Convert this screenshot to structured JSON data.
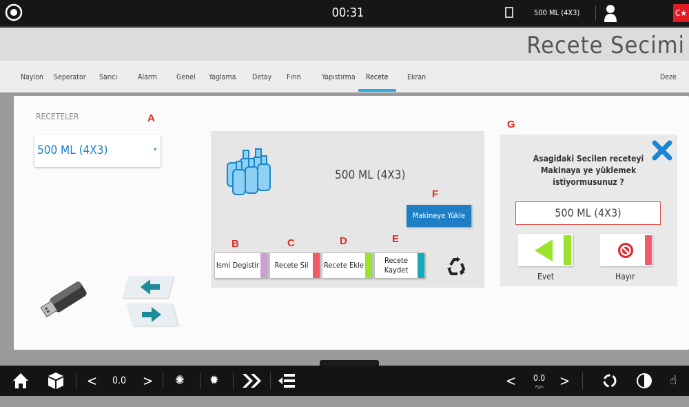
{
  "topbar": {
    "timer": "00:31",
    "recipe": "500 ML  (4X3)"
  },
  "header": {
    "title": "Recete Secimi"
  },
  "tabs": [
    "Naylon",
    "Seperator",
    "Sarıcı",
    "Alarm",
    "Genel",
    "Yaglama",
    "Detay",
    "Fırın",
    "Yapıstırma",
    "Recete",
    "Ekran"
  ],
  "tabs_right": "Deze",
  "active_tab": "Recete",
  "left_panel": {
    "label": "RECETELER",
    "selected": "500 ML  (4X3)"
  },
  "center_panel": {
    "recipe_name": "500 ML  (4X3)",
    "load_button": "Makineye Yükle",
    "buttons": [
      {
        "label": "Ismi Degistir",
        "color": "#c9a0d0"
      },
      {
        "label": "Recete Sil",
        "color": "#f05a6a"
      },
      {
        "label": "Recete Ekle",
        "color": "#9be22c"
      },
      {
        "label": "Recete Kaydet",
        "color": "#18a9b8"
      }
    ]
  },
  "dialog": {
    "message": "Asagidaki Secilen receteyi Makinaya  ye yüklemek istiyormusunuz ?",
    "recipe": "500 ML  (4X3)",
    "yes_label": "Evet",
    "no_label": "Hayır"
  },
  "annotations": [
    "A",
    "B",
    "C",
    "D",
    "E",
    "F",
    "G"
  ],
  "bottom": {
    "value_left": "0.0",
    "value_right": "0.0",
    "value_right_unit": "Ppm"
  },
  "colors": {
    "accent": "#2aa8e0",
    "load_button": "#1f7fc6",
    "yes_green": "#9be22c",
    "no_red": "#f05a6a",
    "annotation_red": "#e12a1f"
  }
}
